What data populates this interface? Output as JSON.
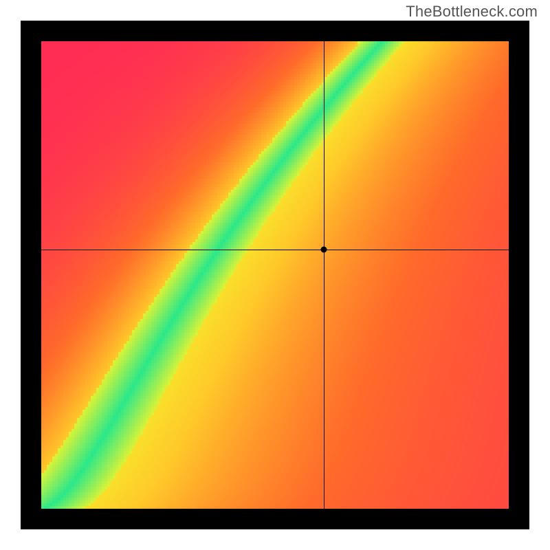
{
  "watermark": "TheBottleneck.com",
  "chart_data": {
    "type": "heatmap",
    "title": "",
    "xlabel": "",
    "ylabel": "",
    "xlim": [
      0,
      1
    ],
    "ylim": [
      0,
      1
    ],
    "crosshair": {
      "x": 0.605,
      "y": 0.555
    },
    "point": {
      "x": 0.605,
      "y": 0.555
    },
    "optimal_curve_notes": "green ridge originates at bottom-left corner, curves upward with increasing steepness; crosshair point sits just right of the ridge",
    "color_scale": [
      "#ff2a55",
      "#ff6a2a",
      "#ffb52a",
      "#ffe02a",
      "#f4f42a",
      "#2ae88a"
    ],
    "grid": false,
    "legend": false
  }
}
